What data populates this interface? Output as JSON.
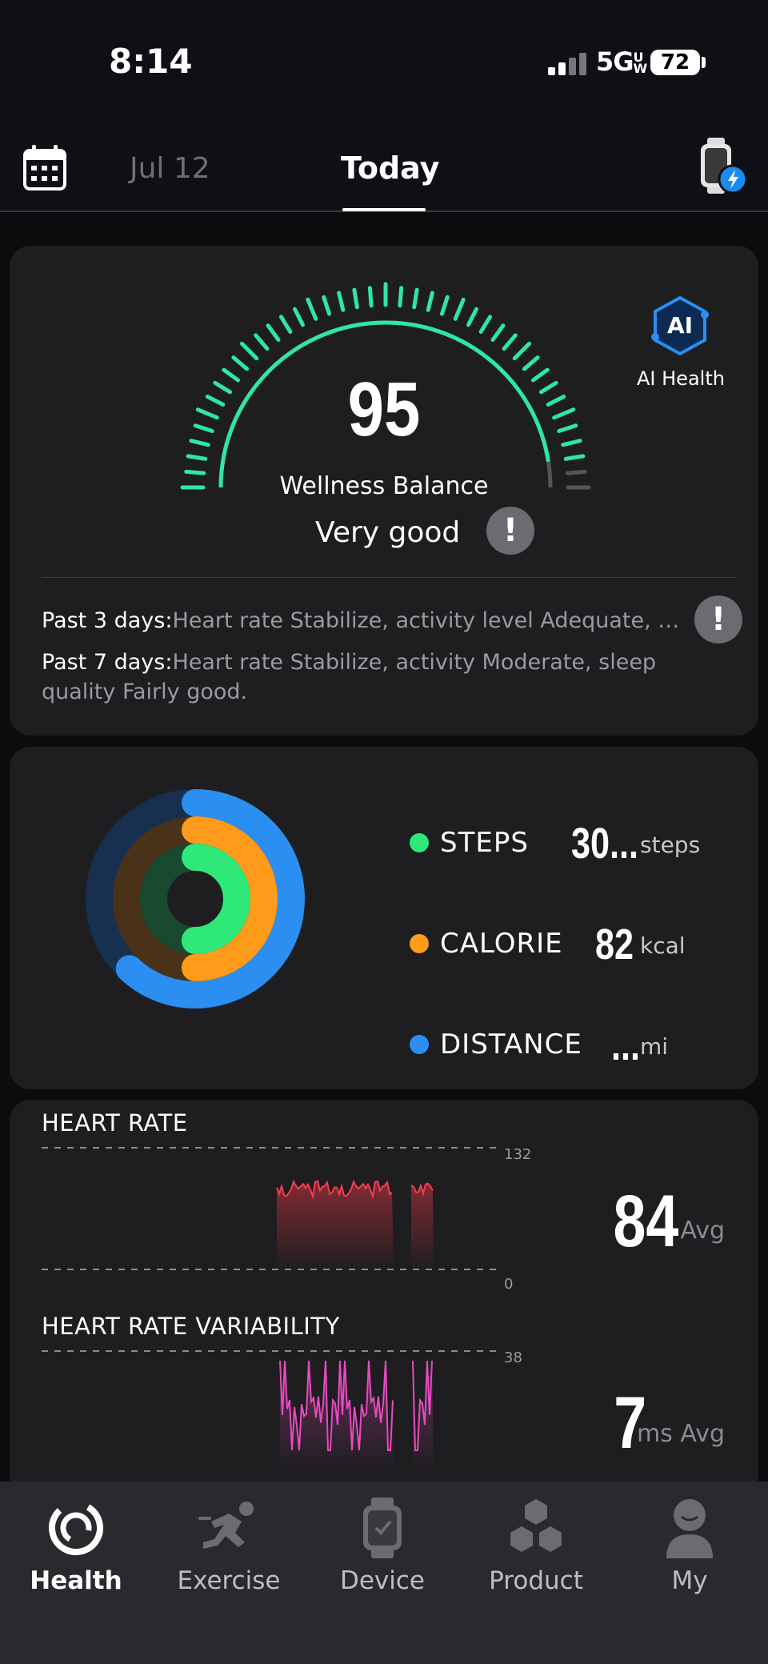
{
  "status_bar": {
    "time": "8:14",
    "network": "5G",
    "network_suffix": "UW",
    "battery": "72"
  },
  "top_nav": {
    "prev_day": "Jul 12",
    "current": "Today",
    "calendar_icon": "calendar-icon",
    "watch_icon": "watch-charging-icon"
  },
  "wellness": {
    "score": "95",
    "score_value": 95,
    "label": "Wellness Balance",
    "rating": "Very good",
    "ai_badge": "AI",
    "ai_label": "AI Health",
    "gauge_color": "#2ee6a6",
    "summaries": [
      {
        "label": "Past 3 days:",
        "text": "Heart rate Stabilize, activity level Adequate, s..."
      },
      {
        "label": "Past 7 days:",
        "text": "Heart rate Stabilize, activity Moderate, sleep quality Fairly good."
      }
    ]
  },
  "activity": {
    "steps": {
      "label": "STEPS",
      "value": "30...",
      "unit": "steps",
      "color": "#2ee879",
      "progress": 0.5
    },
    "calorie": {
      "label": "CALORIE",
      "value": "82",
      "unit": "kcal",
      "color": "#ff9a1a",
      "progress": 0.5
    },
    "distance": {
      "label": "DISTANCE",
      "value": "...",
      "unit": "mi",
      "color": "#2a8ff0",
      "progress": 0.62
    }
  },
  "heart_rate": {
    "title": "HEART RATE",
    "max": "132",
    "min": "0",
    "avg": "84",
    "avg_unit": "Avg",
    "color": "#ff3b4e"
  },
  "hrv": {
    "title": "HEART RATE VARIABILITY",
    "max": "38",
    "avg": "7",
    "avg_unit": "ms Avg",
    "color": "#e84ac0"
  },
  "bottom_nav": [
    {
      "label": "Health",
      "icon": "health-ring-icon",
      "active": true
    },
    {
      "label": "Exercise",
      "icon": "running-icon",
      "active": false
    },
    {
      "label": "Device",
      "icon": "smartwatch-icon",
      "active": false
    },
    {
      "label": "Product",
      "icon": "hexagons-icon",
      "active": false
    },
    {
      "label": "My",
      "icon": "person-icon",
      "active": false
    }
  ]
}
